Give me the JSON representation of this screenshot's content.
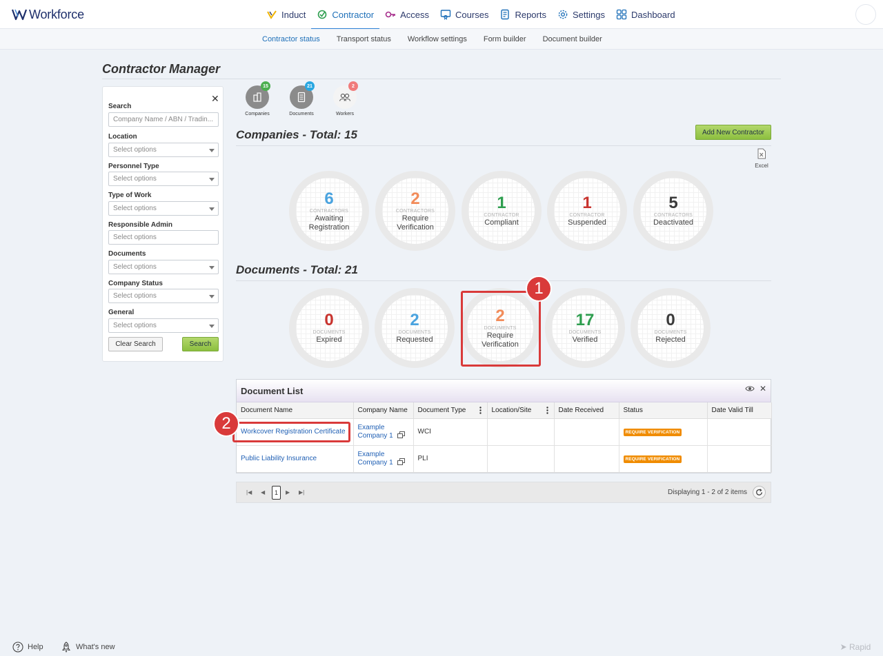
{
  "app": {
    "name": "Workforce"
  },
  "nav": {
    "items": [
      {
        "label": "Induct",
        "icon": "induct-icon"
      },
      {
        "label": "Contractor",
        "icon": "contractor-icon"
      },
      {
        "label": "Access",
        "icon": "access-icon"
      },
      {
        "label": "Courses",
        "icon": "courses-icon"
      },
      {
        "label": "Reports",
        "icon": "reports-icon"
      },
      {
        "label": "Settings",
        "icon": "gear-icon"
      },
      {
        "label": "Dashboard",
        "icon": "dashboard-icon"
      }
    ]
  },
  "subnav": {
    "items": [
      "Contractor status",
      "Transport status",
      "Workflow settings",
      "Form builder",
      "Document builder"
    ]
  },
  "page": {
    "title": "Contractor Manager"
  },
  "filters": {
    "search": {
      "label": "Search",
      "placeholder": "Company Name / ABN / Tradin..."
    },
    "location": {
      "label": "Location",
      "value": "Select options"
    },
    "personnel_type": {
      "label": "Personnel Type",
      "value": "Select options"
    },
    "type_of_work": {
      "label": "Type of Work",
      "value": "Select options"
    },
    "responsible_admin": {
      "label": "Responsible Admin",
      "value": "Select options"
    },
    "documents": {
      "label": "Documents",
      "value": "Select options"
    },
    "company_status": {
      "label": "Company Status",
      "value": "Select options"
    },
    "general": {
      "label": "General",
      "value": "Select options"
    },
    "clear_label": "Clear Search",
    "search_label": "Search"
  },
  "summary": [
    {
      "label": "Companies",
      "count": "15",
      "color": "#4caf50"
    },
    {
      "label": "Documents",
      "count": "21",
      "color": "#29a7e1"
    },
    {
      "label": "Workers",
      "count": "2",
      "color": "#f07b7b"
    }
  ],
  "companies": {
    "title": "Companies - Total: 15",
    "add_label": "Add New Contractor",
    "excel_label": "Excel",
    "stats": [
      {
        "value": "6",
        "caption": "CONTRACTORS",
        "label": "Awaiting Registration",
        "color": "#4aa3df"
      },
      {
        "value": "2",
        "caption": "CONTRACTORS",
        "label": "Require Verification",
        "color": "#f28c5a"
      },
      {
        "value": "1",
        "caption": "CONTRACTOR",
        "label": "Compliant",
        "color": "#2e9e4f"
      },
      {
        "value": "1",
        "caption": "CONTRACTOR",
        "label": "Suspended",
        "color": "#c8332e"
      },
      {
        "value": "5",
        "caption": "CONTRACTORS",
        "label": "Deactivated",
        "color": "#3a3a3a"
      }
    ]
  },
  "documents": {
    "title": "Documents - Total: 21",
    "stats": [
      {
        "value": "0",
        "caption": "DOCUMENTS",
        "label": "Expired",
        "color": "#c8332e"
      },
      {
        "value": "2",
        "caption": "DOCUMENTS",
        "label": "Requested",
        "color": "#4aa3df"
      },
      {
        "value": "2",
        "caption": "DOCUMENTS",
        "label": "Require Verification",
        "color": "#f28c5a"
      },
      {
        "value": "17",
        "caption": "DOCUMENTS",
        "label": "Verified",
        "color": "#2e9e4f"
      },
      {
        "value": "0",
        "caption": "DOCUMENTS",
        "label": "Rejected",
        "color": "#3a3a3a"
      }
    ]
  },
  "callouts": [
    "1",
    "2"
  ],
  "doclist": {
    "title": "Document List",
    "columns": [
      "Document Name",
      "Company Name",
      "Document Type",
      "Location/Site",
      "Date Received",
      "Status",
      "Date Valid Till"
    ],
    "rows": [
      {
        "name": "Workcover Registration Certificate",
        "company_line1": "Example",
        "company_line2": "Company 1",
        "type": "WCI",
        "location": "",
        "received": "",
        "status": "REQUIRE VERIFICATION",
        "valid": ""
      },
      {
        "name": "Public Liability Insurance",
        "company_line1": "Example",
        "company_line2": "Company 1",
        "type": "PLI",
        "location": "",
        "received": "",
        "status": "REQUIRE VERIFICATION",
        "valid": ""
      }
    ]
  },
  "pager": {
    "current": "1",
    "info": "Displaying 1 - 2 of 2 items"
  },
  "footer": {
    "help": "Help",
    "whats_new": "What's new",
    "brand": "Rapid"
  }
}
